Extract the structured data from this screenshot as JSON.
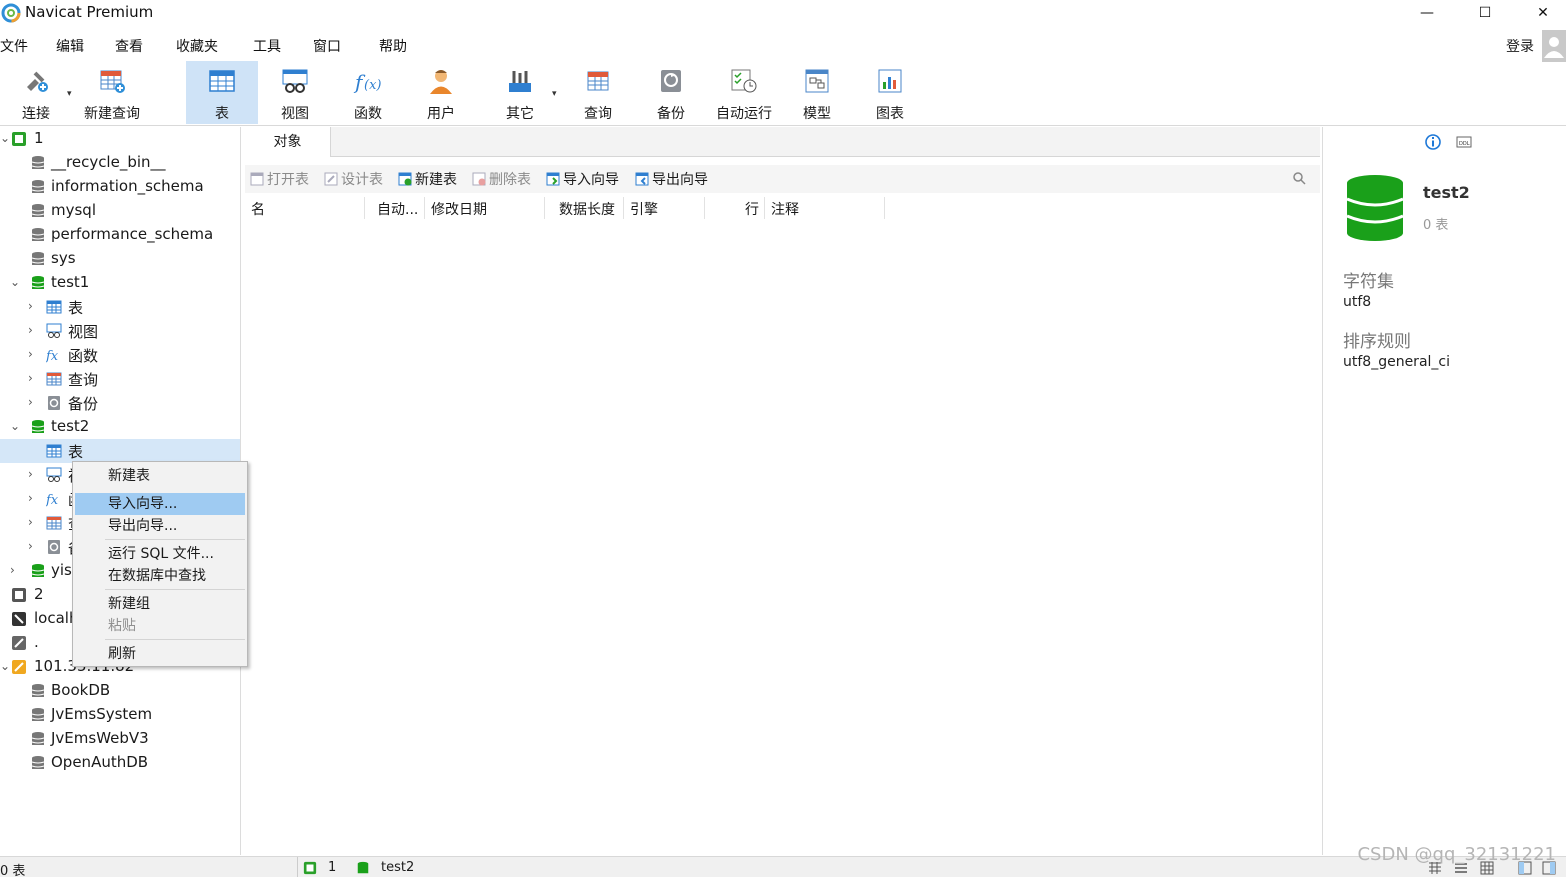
{
  "window": {
    "title": "Navicat Premium",
    "minimize": "—",
    "maximize": "☐",
    "close": "✕"
  },
  "menubar": {
    "items": [
      "文件",
      "编辑",
      "查看",
      "收藏夹",
      "工具",
      "窗口",
      "帮助"
    ],
    "login": "登录"
  },
  "toolbar": {
    "tools": [
      {
        "label": "连接",
        "icon": "connection-icon"
      },
      {
        "label": "新建查询",
        "icon": "new-query-icon"
      },
      {
        "label": "表",
        "icon": "table-icon",
        "active": true
      },
      {
        "label": "视图",
        "icon": "view-icon"
      },
      {
        "label": "函数",
        "icon": "function-icon"
      },
      {
        "label": "用户",
        "icon": "user-icon"
      },
      {
        "label": "其它",
        "icon": "other-icon"
      },
      {
        "label": "查询",
        "icon": "query-icon"
      },
      {
        "label": "备份",
        "icon": "backup-icon"
      },
      {
        "label": "自动运行",
        "icon": "automation-icon"
      },
      {
        "label": "模型",
        "icon": "model-icon"
      },
      {
        "label": "图表",
        "icon": "chart-icon"
      }
    ]
  },
  "tree": {
    "nodes": [
      {
        "label": "1",
        "icon": "mysql-connection-icon",
        "expanded": true
      },
      {
        "label": "__recycle_bin__",
        "icon": "database-icon"
      },
      {
        "label": "information_schema",
        "icon": "database-icon"
      },
      {
        "label": "mysql",
        "icon": "database-icon"
      },
      {
        "label": "performance_schema",
        "icon": "database-icon"
      },
      {
        "label": "sys",
        "icon": "database-icon"
      },
      {
        "label": "test1",
        "icon": "database-open-icon",
        "expanded": true
      },
      {
        "label": "表",
        "icon": "table-icon"
      },
      {
        "label": "视图",
        "icon": "view-icon"
      },
      {
        "label": "函数",
        "icon": "function-icon"
      },
      {
        "label": "查询",
        "icon": "query-icon"
      },
      {
        "label": "备份",
        "icon": "backup-icon"
      },
      {
        "label": "test2",
        "icon": "database-open-icon",
        "expanded": true
      },
      {
        "label": "表",
        "icon": "table-icon",
        "selected": true
      },
      {
        "label": "视图",
        "icon": "view-icon"
      },
      {
        "label": "函数",
        "icon": "function-icon"
      },
      {
        "label": "查询",
        "icon": "query-icon"
      },
      {
        "label": "备份",
        "icon": "backup-icon"
      },
      {
        "label": "yisha",
        "icon": "database-open-icon"
      },
      {
        "label": "2",
        "icon": "mysql-connection-icon"
      },
      {
        "label": "localhost",
        "icon": "connection-icon"
      },
      {
        "label": ".",
        "icon": "connection-icon"
      },
      {
        "label": "101.35.11.82",
        "icon": "sqlserver-connection-icon",
        "expanded": true
      },
      {
        "label": "BookDB",
        "icon": "database-icon"
      },
      {
        "label": "JvEmsSystem",
        "icon": "database-icon"
      },
      {
        "label": "JvEmsWebV3",
        "icon": "database-icon"
      },
      {
        "label": "OpenAuthDB",
        "icon": "database-icon"
      }
    ]
  },
  "center": {
    "tab": "对象",
    "actions": [
      {
        "label": "打开表",
        "enabled": false
      },
      {
        "label": "设计表",
        "enabled": false
      },
      {
        "label": "新建表",
        "enabled": true
      },
      {
        "label": "删除表",
        "enabled": false
      },
      {
        "label": "导入向导",
        "enabled": true
      },
      {
        "label": "导出向导",
        "enabled": true
      }
    ],
    "columns": [
      "名",
      "自动...",
      "修改日期",
      "数据长度",
      "引擎",
      "行",
      "注释"
    ]
  },
  "info_panel": {
    "db_name": "test2",
    "table_count": "0 表",
    "charset_label": "字符集",
    "charset_value": "utf8",
    "collation_label": "排序规则",
    "collation_value": "utf8_general_ci"
  },
  "context_menu": {
    "items": [
      {
        "label": "新建表"
      },
      {
        "label": "导入向导...",
        "highlighted": true
      },
      {
        "label": "导出向导..."
      },
      {
        "label": "运行 SQL 文件..."
      },
      {
        "label": "在数据库中查找"
      },
      {
        "label": "新建组"
      },
      {
        "label": "粘贴",
        "disabled": true
      },
      {
        "label": "刷新"
      }
    ]
  },
  "statusbar": {
    "left": "0 表",
    "connection": "1",
    "database": "test2"
  },
  "watermark": "CSDN @qq_32131221",
  "colors": {
    "db_green": "#1aa01a",
    "selection": "#d5e7f8",
    "menu_highlight": "#9fcbf2",
    "info_blue": "#1e78d7"
  }
}
